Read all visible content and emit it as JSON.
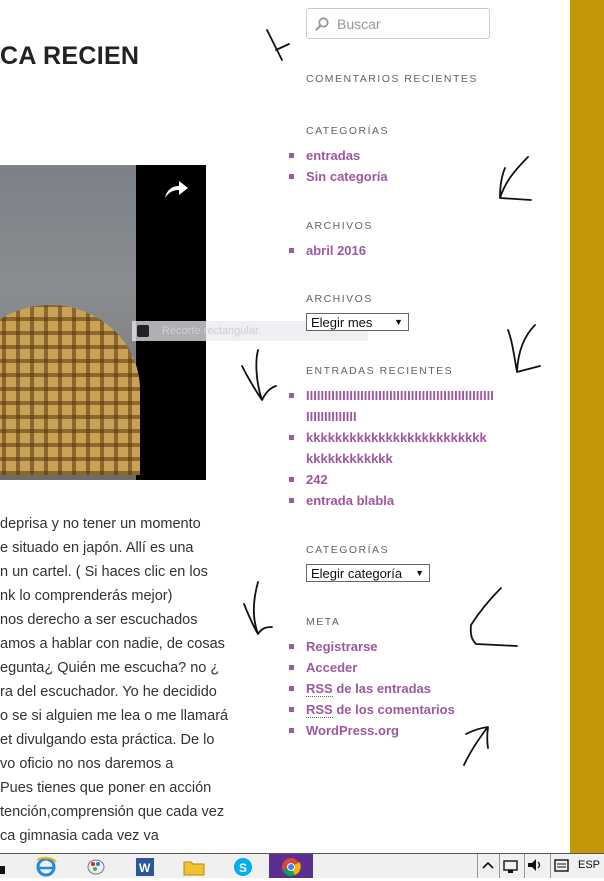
{
  "post": {
    "title": "CA RECIEN",
    "body_lines": [
      "deprisa y no tener un momento",
      "e situado en japón. Allí es una",
      "n un cartel. ( Si haces clic en los",
      "nk lo comprenderás mejor)",
      "nos derecho a ser escuchados",
      "amos a hablar con nadie, de cosas",
      "egunta¿ Quién me escucha? no ¿",
      "ra del escuchador. Yo he decidido",
      "o se si alguien me lea o me llamará",
      "et divulgando esta práctica. De lo",
      "vo oficio no nos daremos a",
      "Pues tienes que poner en acción",
      "tención,comprensión que cada vez",
      "ca gimnasia cada vez va"
    ]
  },
  "video": {
    "share_icon": "share-arrow-icon"
  },
  "snip_overlay": {
    "label": "Recorte rectangular"
  },
  "sidebar": {
    "search_placeholder": "Buscar",
    "recent_comments_title": "COMENTARIOS RECIENTES",
    "categories_title": "CATEGORÍAS",
    "categories": [
      "entradas",
      "Sin categoría"
    ],
    "archives_title": "ARCHIVOS",
    "archives": [
      "abril 2016"
    ],
    "archives_dropdown_title": "ARCHIVOS",
    "archives_dropdown_value": "Elegir mes",
    "recent_posts_title": "ENTRADAS RECIENTES",
    "recent_posts": [
      "IIIIIIIIIIIIIIIIIIIIIIIIIIIIIIIIIIIIIIIIIIIIIIIIIIIIIIIIIIIIIIIIII",
      "kkkkkkkkkkkkkkkkkkkkkkkkkkkkkkkkkkkkk",
      "242",
      "entrada blabla"
    ],
    "categories_dropdown_title": "CATEGORÍAS",
    "categories_dropdown_value": "Elegir categoría",
    "meta_title": "META",
    "meta": {
      "register": "Registrarse",
      "login": "Acceder",
      "rss_abbr": "RSS",
      "entries_rss": "de las entradas",
      "comments_rss": "de los comentarios",
      "wordpress": "WordPress.org"
    }
  },
  "taskbar": {
    "language": "ESP",
    "apps": [
      "ie-icon",
      "paint-icon",
      "word-icon",
      "file-explorer-icon",
      "skype-icon",
      "chrome-icon"
    ]
  },
  "colors": {
    "accent_gold": "#c4960a",
    "link_purple": "#9f579f"
  }
}
